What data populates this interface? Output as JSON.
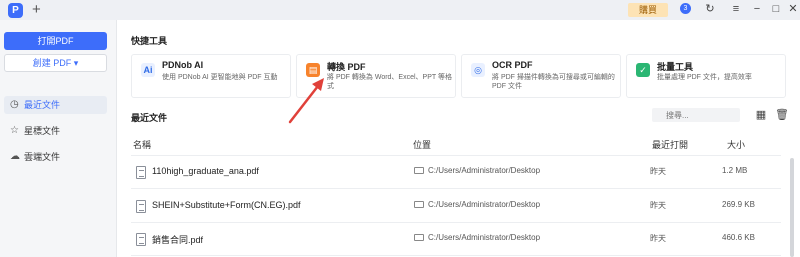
{
  "titlebar": {
    "logo_text": "P",
    "new_tab_glyph": "+",
    "buy_label": "購買",
    "avatar_text": "3"
  },
  "sidebar": {
    "open_label": "打開PDF",
    "create_label": "創建 PDF ▾",
    "items": [
      {
        "label": "最近文件",
        "icon": "clock-icon"
      },
      {
        "label": "星標文件",
        "icon": "star-icon"
      },
      {
        "label": "雲端文件",
        "icon": "cloud-icon"
      }
    ]
  },
  "quick_tools": {
    "title": "快捷工具",
    "tools": [
      {
        "title": "PDNob AI",
        "desc": "使用 PDNob AI 更智能地與 PDF 互動",
        "icon_text": "Ai",
        "color": "#2f6be6",
        "bg": "#e9f0ff"
      },
      {
        "title": "轉換 PDF",
        "desc": "將 PDF 轉換為 Word、Excel、PPT 等格式",
        "icon_text": "▤",
        "color": "#ffffff",
        "bg": "#f7832c"
      },
      {
        "title": "OCR PDF",
        "desc": "將 PDF 掃描件轉換為可搜尋或可編輯的 PDF 文件",
        "icon_text": "◎",
        "color": "#2f6be6",
        "bg": "#e9f0ff"
      },
      {
        "title": "批量工具",
        "desc": "批量處理 PDF 文件，提高效率",
        "icon_text": "✓",
        "color": "#ffffff",
        "bg": "#2bb673"
      }
    ]
  },
  "recent": {
    "title": "最近文件",
    "search_placeholder": "搜尋...",
    "columns": {
      "name": "名稱",
      "location": "位置",
      "last_opened": "最近打開",
      "size": "大小"
    },
    "files": [
      {
        "name": "110high_graduate_ana.pdf",
        "location": "C:/Users/Administrator/Desktop",
        "last_opened": "昨天",
        "size": "1.2 MB"
      },
      {
        "name": "SHEIN+Substitute+Form(CN.EG).pdf",
        "location": "C:/Users/Administrator/Desktop",
        "last_opened": "昨天",
        "size": "269.9 KB"
      },
      {
        "name": "銷售合同.pdf",
        "location": "C:/Users/Administrator/Desktop",
        "last_opened": "昨天",
        "size": "460.6 KB"
      }
    ]
  },
  "colors": {
    "accent": "#3d6dfa",
    "arrow": "#e0413a"
  }
}
